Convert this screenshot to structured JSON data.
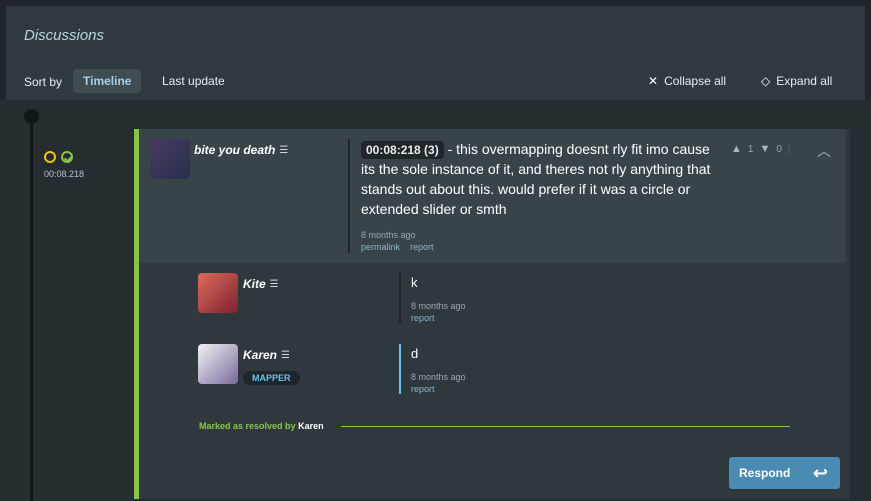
{
  "header": {
    "title": "Discussions",
    "sort_label": "Sort by",
    "tabs": [
      {
        "label": "Timeline",
        "active": true
      },
      {
        "label": "Last update",
        "active": false
      }
    ],
    "collapse_all": "Collapse all",
    "expand_all": "Expand all"
  },
  "timeline": {
    "timestamp": "00:08.218"
  },
  "discussion": {
    "post": {
      "username": "bite you death",
      "timestamp_badge": "00:08:218 (3)",
      "message": " - this overmapping doesnt rly fit imo cause its the sole instance of it, and theres not rly anything that stands out about this. would prefer if it was a circle or extended slider or smth",
      "time_ago": "8 months ago",
      "permalink": "permalink",
      "report": "report",
      "upvotes": "1",
      "downvotes": "0"
    },
    "replies": [
      {
        "username": "Kite",
        "message": "k",
        "time_ago": "8 months ago",
        "report": "report"
      },
      {
        "username": "Karen",
        "badge": "MAPPER",
        "message": "d",
        "time_ago": "8 months ago",
        "report": "report"
      }
    ],
    "resolved_text": "Marked as resolved by",
    "resolved_by": "Karen",
    "respond_label": "Respond"
  },
  "colors": {
    "accent_green": "#87c54a",
    "accent_blue": "#4a8bb4",
    "mapper_blue": "#6bc1ec"
  }
}
